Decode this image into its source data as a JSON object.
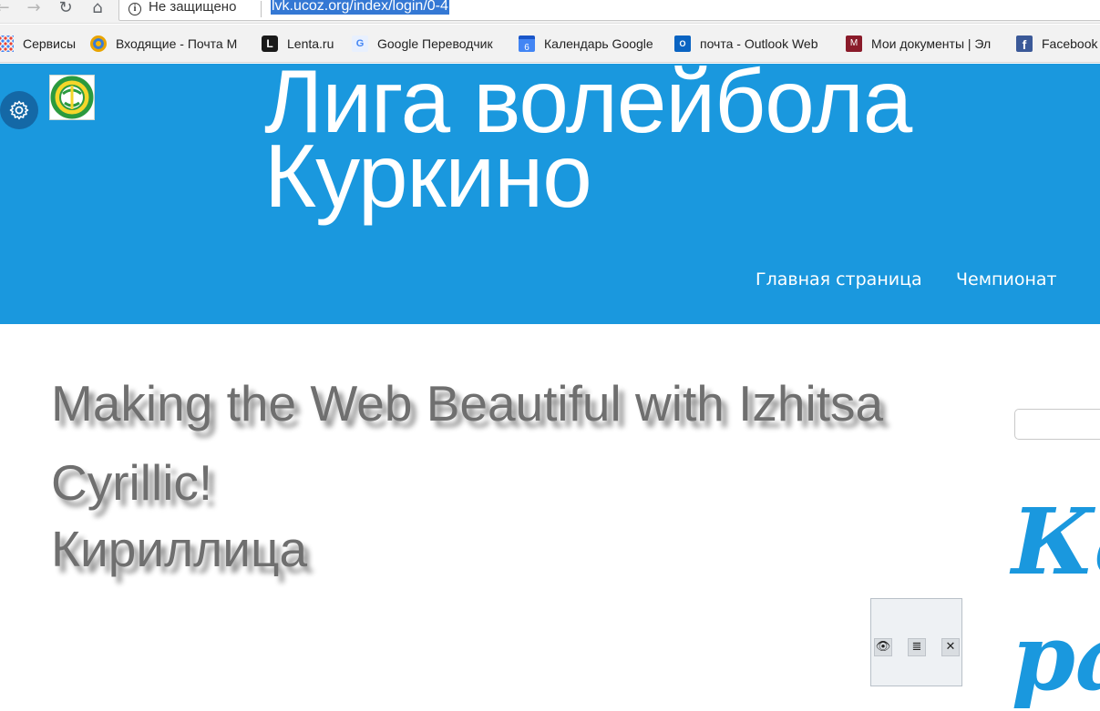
{
  "browser": {
    "security_label": "Не защищено",
    "url": "lvk.ucoz.org/index/login/0-4",
    "nav_icons": [
      "back-arrow-icon",
      "forward-arrow-icon",
      "reload-icon",
      "home-icon"
    ]
  },
  "bookmarks": [
    {
      "label": "Сервисы",
      "icon": "apps-icon"
    },
    {
      "label": "Входящие - Почта М",
      "icon": "mail-icon"
    },
    {
      "label": "Lenta.ru",
      "icon": "lenta-icon"
    },
    {
      "label": "Google Переводчик",
      "icon": "google-translate-icon"
    },
    {
      "label": "Календарь Google",
      "icon": "google-calendar-icon"
    },
    {
      "label": "почта - Outlook Web",
      "icon": "outlook-icon"
    },
    {
      "label": "Мои документы | Эл",
      "icon": "documents-icon"
    },
    {
      "label": "Facebook",
      "icon": "facebook-icon"
    }
  ],
  "site": {
    "title_line1": "Лига волейбола",
    "title_line2": "Куркино",
    "nav": [
      {
        "label": "Главная страница"
      },
      {
        "label": "Чемпионат"
      }
    ],
    "header_color": "#1a98de"
  },
  "content": {
    "title_line1": "Making the Web Beautiful with Izhitsa",
    "title_line2": "Cyrillic!",
    "title_line3": "Кириллица"
  },
  "sidebar": {
    "deco_line1": "Ка",
    "deco_line2": "ра"
  },
  "float_toolbar": {
    "icons": [
      "eye-icon",
      "list-icon",
      "tools-icon"
    ]
  }
}
